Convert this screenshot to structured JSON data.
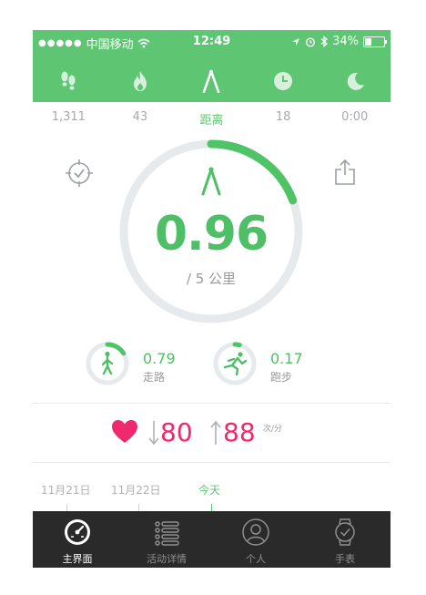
{
  "status_bar": {
    "carrier": "中国移动",
    "time": "12:49",
    "battery": "34%",
    "battery_level": 0.34
  },
  "metric_tabs": [
    {
      "icon": "footsteps-icon",
      "value": "1,311"
    },
    {
      "icon": "flame-icon",
      "value": "43"
    },
    {
      "icon": "compass-distance-icon",
      "value": "距离",
      "active": true
    },
    {
      "icon": "clock-icon",
      "value": "18"
    },
    {
      "icon": "moon-icon",
      "value": "0:00"
    }
  ],
  "main": {
    "value": "0.96",
    "goal": "/ 5 公里",
    "progress": 0.192
  },
  "breakdown": [
    {
      "value": "0.79",
      "label": "走路",
      "icon": "walking-icon",
      "progress": 0.16
    },
    {
      "value": "0.17",
      "label": "跑步",
      "icon": "running-icon",
      "progress": 0.04
    }
  ],
  "heart_rate": {
    "low": "80",
    "high": "88",
    "unit": "次/分"
  },
  "timeline": {
    "dates": [
      "11月21日",
      "11月22日",
      "今天"
    ]
  },
  "nav": [
    {
      "label": "主界面",
      "icon": "dashboard-icon",
      "active": true
    },
    {
      "label": "活动详情",
      "icon": "list-icon"
    },
    {
      "label": "个人",
      "icon": "person-icon"
    },
    {
      "label": "手表",
      "icon": "watch-icon"
    }
  ],
  "colors": {
    "accent_green": "#5ec672",
    "heart_pink": "#f0286e",
    "nav_bg": "#2a2a2a"
  }
}
